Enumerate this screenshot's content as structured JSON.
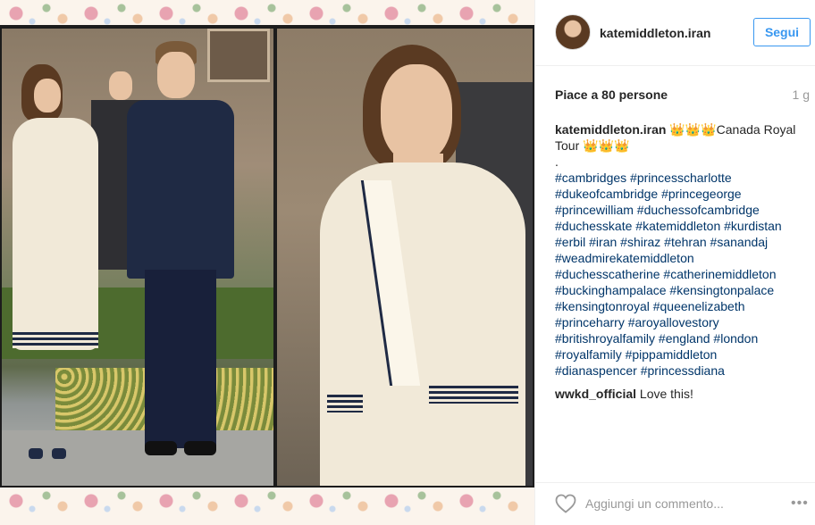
{
  "post": {
    "username": "katemiddleton.iran",
    "follow_label": "Segui",
    "likes": "Piace a 80 persone",
    "time": "1 g",
    "caption_author": "katemiddleton.iran",
    "caption_line1": "👑👑👑Canada Royal",
    "caption_line2": "Tour 👑👑👑",
    "caption_dot": ".",
    "hashtags": [
      "#cambridges #princesscharlotte",
      "#dukeofcambridge #princegeorge",
      "#princewilliam #duchessofcambridge",
      "#duchesskate #katemiddleton #kurdistan",
      "#erbil #iran #shiraz #tehran #sanandaj",
      "#weadmirekatemiddleton",
      "#duchesscatherine #catherinemiddleton",
      "#buckinghampalace #kensingtonpalace",
      "#kensingtonroyal #queenelizabeth",
      "#princeharry #aroyallovestory",
      "#britishroyalfamily #england #london",
      "#royalfamily #pippamiddleton",
      "#dianaspencer #princessdiana"
    ],
    "comment_author": "wwkd_official",
    "comment_text": " Love this!"
  },
  "footer": {
    "comment_placeholder": "Aggiungi un commento...",
    "more_label": "•••"
  },
  "icons": {
    "heart": "heart-icon",
    "more": "more-options-icon"
  },
  "colors": {
    "follow_blue": "#3897f0",
    "hashtag": "#003569",
    "muted": "#999999"
  }
}
